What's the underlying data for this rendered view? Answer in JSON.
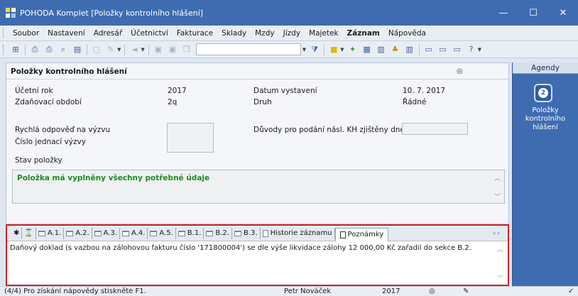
{
  "window": {
    "title": "POHODA Komplet  [Položky kontrolního hlášení]",
    "minimize": "—",
    "maximize": "☐",
    "close": "✕"
  },
  "menu": [
    "Soubor",
    "Nastavení",
    "Adresář",
    "Účetnictví",
    "Fakturace",
    "Sklady",
    "Mzdy",
    "Jízdy",
    "Majetek",
    "Záznam",
    "Nápověda"
  ],
  "menu_bold_index": 9,
  "toolbar": {
    "combo_value": ""
  },
  "panel": {
    "title": "Položky kontrolního hlášení",
    "ucetni_rok_label": "Účetní rok",
    "ucetni_rok_value": "2017",
    "zdanovaci_obdobi_label": "Zdaňovací období",
    "zdanovaci_obdobi_value": "2q",
    "datum_vystaveni_label": "Datum vystavení",
    "datum_vystaveni_value": "10. 7. 2017",
    "druh_label": "Druh",
    "druh_value": "Řádné",
    "rychla_odpoved_label": "Rychlá odpověď na výzvu",
    "cislo_jednaci_label": "Číslo jednací výzvy",
    "duvody_label": "Důvody pro podání násl. KH zjištěny dne",
    "stav_polozky_label": "Stav položky",
    "stav_polozky_text": "Položka má vyplněny všechny potřebné údaje"
  },
  "tabs": [
    "✱",
    "⌛",
    "A.1.",
    "A.2.",
    "A.3.",
    "A.4.",
    "A.5.",
    "B.1.",
    "B.2.",
    "B.3.",
    "Historie záznamu",
    "Poznámky"
  ],
  "active_tab": "Poznámky",
  "tab_content": "Daňový doklad (s vazbou na zálohovou fakturu číslo '171800004') se dle výše likvidace zálohy 12 000,00 Kč zařadil do sekce B.2.",
  "agendy": {
    "header": "Agendy",
    "item_label": "Položky\nkontrolního\nhlášení"
  },
  "status": {
    "help": "(4/4) Pro získání nápovědy stiskněte F1.",
    "user": "Petr Nováček",
    "year": "2017"
  }
}
